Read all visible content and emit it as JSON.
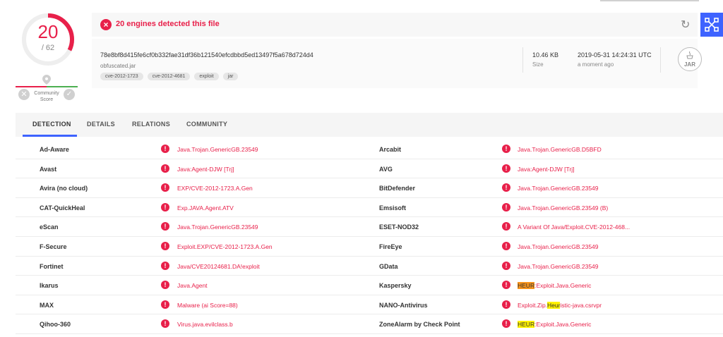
{
  "score": {
    "detected": "20",
    "total": "/ 62"
  },
  "community": {
    "label_line1": "Community",
    "label_line2": "Score"
  },
  "banner": {
    "text": "20 engines detected this file"
  },
  "file": {
    "hash": "78e8bf8d415fe6cf0b332fae31df36b121540efcdbbd5ed13497f5a678d724d4",
    "name": "obfuscated.jar",
    "tags": [
      "cve-2012-1723",
      "cve-2012-4681",
      "exploit",
      "jar"
    ],
    "size_value": "10.46 KB",
    "size_label": "Size",
    "date_value": "2019-05-31 14:24:31 UTC",
    "date_label": "a moment ago",
    "type_badge": "JAR"
  },
  "tabs": [
    {
      "label": "DETECTION"
    },
    {
      "label": "DETAILS"
    },
    {
      "label": "RELATIONS"
    },
    {
      "label": "COMMUNITY"
    }
  ],
  "detections": [
    {
      "left_engine": "Ad-Aware",
      "left_result": "Java.Trojan.GenericGB.23549",
      "right_engine": "Arcabit",
      "right_result": "Java.Trojan.GenericGB.D5BFD"
    },
    {
      "left_engine": "Avast",
      "left_result": "Java:Agent-DJW [Trj]",
      "right_engine": "AVG",
      "right_result": "Java:Agent-DJW [Trj]"
    },
    {
      "left_engine": "Avira (no cloud)",
      "left_result": "EXP/CVE-2012-1723.A.Gen",
      "right_engine": "BitDefender",
      "right_result": "Java.Trojan.GenericGB.23549"
    },
    {
      "left_engine": "CAT-QuickHeal",
      "left_result": "Exp.JAVA.Agent.ATV",
      "right_engine": "Emsisoft",
      "right_result": "Java.Trojan.GenericGB.23549 (B)"
    },
    {
      "left_engine": "eScan",
      "left_result": "Java.Trojan.GenericGB.23549",
      "right_engine": "ESET-NOD32",
      "right_result": "A Variant Of Java/Exploit.CVE-2012-468..."
    },
    {
      "left_engine": "F-Secure",
      "left_result": "Exploit.EXP/CVE-2012-1723.A.Gen",
      "right_engine": "FireEye",
      "right_result": "Java.Trojan.GenericGB.23549"
    },
    {
      "left_engine": "Fortinet",
      "left_result": "Java/CVE20124681.DA!exploit",
      "right_engine": "GData",
      "right_result": "Java.Trojan.GenericGB.23549"
    },
    {
      "left_engine": "Ikarus",
      "left_result": "Java.Agent",
      "right_engine": "Kaspersky",
      "right_hl": "HEUR",
      "right_hl_style": "orange",
      "right_rest": ":Exploit.Java.Generic"
    },
    {
      "left_engine": "MAX",
      "left_result": "Malware (ai Score=88)",
      "right_engine": "NANO-Antivirus",
      "right_pre": "Exploit.Zip.",
      "right_hl": "Heur",
      "right_hl_style": "yellow",
      "right_rest": "istic-java.csrvpr"
    },
    {
      "left_engine": "Qihoo-360",
      "left_result": "Virus.java.evilclass.b",
      "right_engine": "ZoneAlarm by Check Point",
      "right_hl": "HEUR",
      "right_hl_style": "yellow",
      "right_rest": ":Exploit.Java.Generic"
    }
  ],
  "icons": {
    "ring": "detection-ring",
    "banner": "alert-x-icon",
    "reload": "reload-icon",
    "graph": "graph-network-icon",
    "detection": "alert-exclamation-icon"
  },
  "colors": {
    "accent_red": "#e8204a",
    "brand_blue": "#3e63ff",
    "good_green": "#4caf50"
  }
}
